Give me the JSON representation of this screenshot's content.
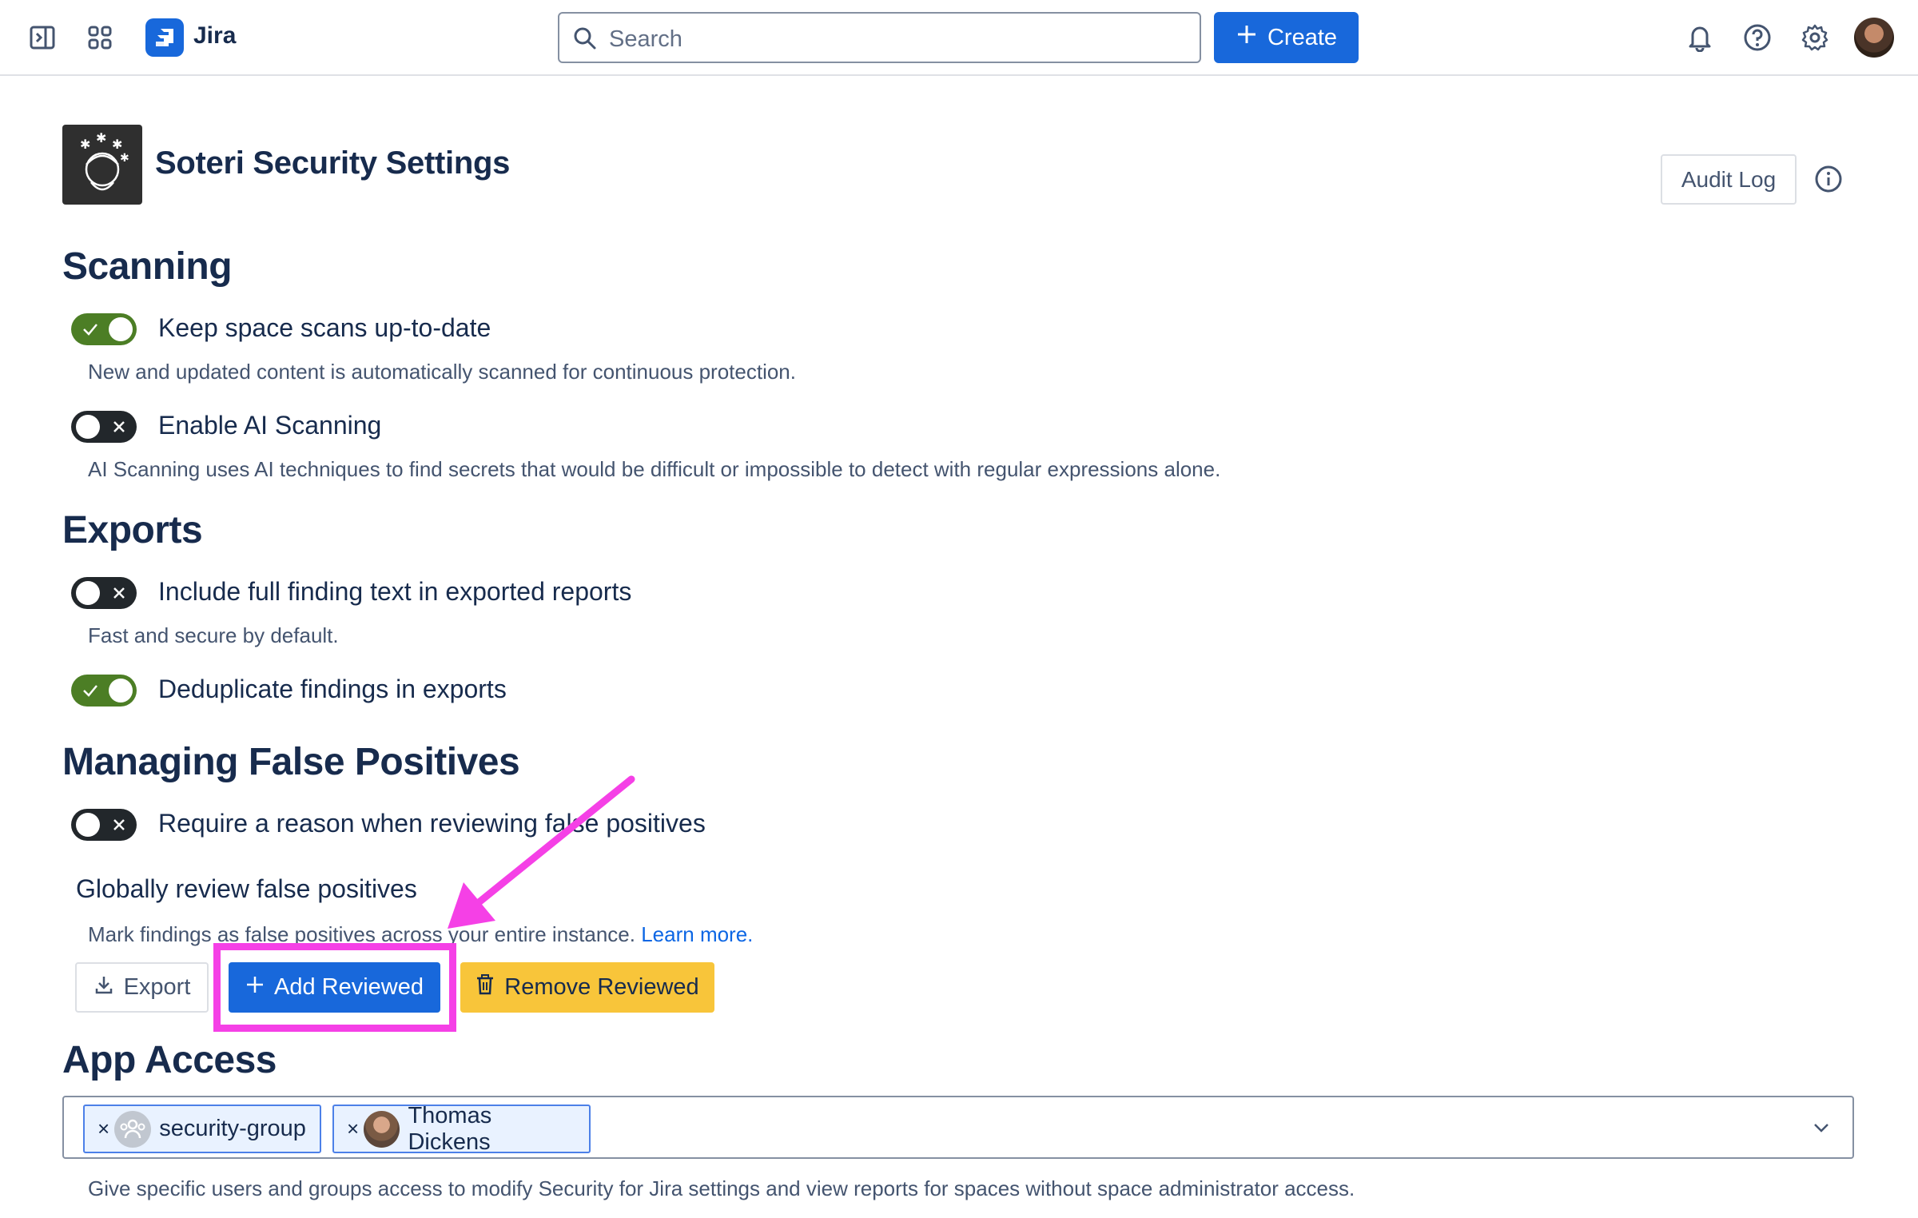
{
  "topbar": {
    "app_name": "Jira",
    "search_placeholder": "Search",
    "create_label": "Create"
  },
  "header": {
    "title": "Soteri Security Settings",
    "audit_log_label": "Audit Log"
  },
  "scanning": {
    "heading": "Scanning",
    "keep_scans": {
      "label": "Keep space scans up-to-date",
      "enabled": true,
      "description": "New and updated content is automatically scanned for continuous protection."
    },
    "ai_scanning": {
      "label": "Enable AI Scanning",
      "enabled": false,
      "description": "AI Scanning uses AI techniques to find secrets that would be difficult or impossible to detect with regular expressions alone."
    }
  },
  "exports": {
    "heading": "Exports",
    "full_text": {
      "label": "Include full finding text in exported reports",
      "enabled": false,
      "description": "Fast and secure by default."
    },
    "deduplicate": {
      "label": "Deduplicate findings in exports",
      "enabled": true
    }
  },
  "false_positives": {
    "heading": "Managing False Positives",
    "require_reason": {
      "label": "Require a reason when reviewing false positives",
      "enabled": false
    },
    "global_review": {
      "title": "Globally review false positives",
      "description": "Mark findings as false positives across your entire instance.",
      "learn_more": "Learn more.",
      "export_label": "Export",
      "add_label": "Add Reviewed",
      "remove_label": "Remove Reviewed"
    }
  },
  "app_access": {
    "heading": "App Access",
    "chips": [
      {
        "label": "security-group",
        "remove": "×"
      },
      {
        "label": "Thomas Dickens",
        "remove": "×"
      }
    ],
    "description": "Give specific users and groups access to modify Security for Jira settings and view reports for spaces without space administrator access."
  },
  "colors": {
    "primary": "#1868db",
    "toggle_on": "#4c7e25",
    "toggle_off": "#22272b",
    "warning": "#f8c53a",
    "annotation": "#f540e6"
  }
}
